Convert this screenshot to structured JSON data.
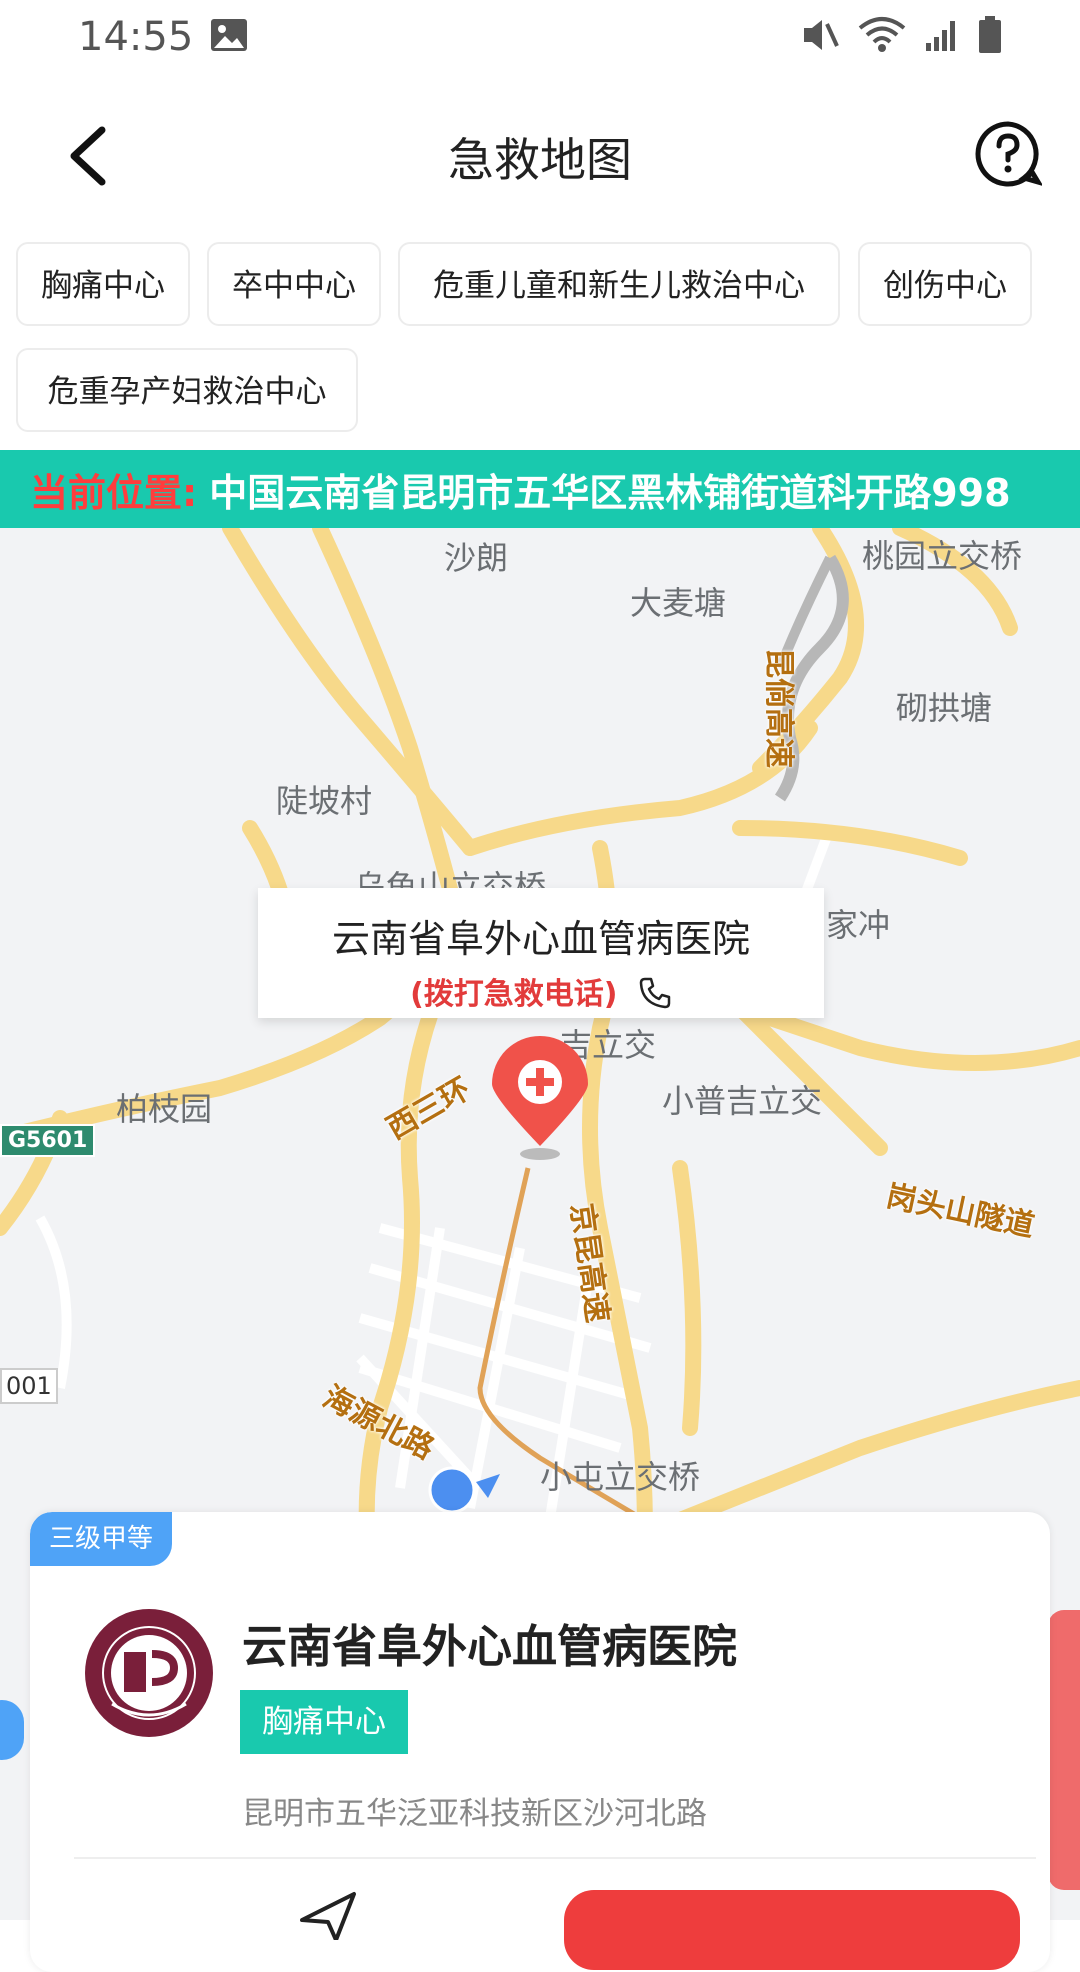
{
  "status": {
    "time": "14:55"
  },
  "header": {
    "title": "急救地图"
  },
  "chips": [
    "胸痛中心",
    "卒中中心",
    "危重儿童和新生儿救治中心",
    "创伤中心",
    "危重孕产妇救治中心"
  ],
  "location": {
    "label": "当前位置:",
    "address": "中国云南省昆明市五华区黑林铺街道科开路998"
  },
  "map": {
    "places": [
      "沙朗",
      "桃园立交桥",
      "大麦塘",
      "砌拱塘",
      "陡坡村",
      "乌龟山立交桥",
      "家冲",
      "吉立交",
      "小普吉立交",
      "柏枝园",
      "小屯立交桥"
    ],
    "roads": [
      "昆倘高速",
      "西三环",
      "京昆高速",
      "岗头山隧道",
      "海源北路"
    ],
    "shields": [
      "G5601",
      "001"
    ]
  },
  "popup": {
    "name": "云南省阜外心血管病医院",
    "call": "(拨打急救电话)"
  },
  "card": {
    "grade": "三级甲等",
    "name": "云南省阜外心血管病医院",
    "tag": "胸痛中心",
    "address": "昆明市五华泛亚科技新区沙河北路"
  },
  "colors": {
    "accent": "#19c9ae",
    "danger": "#ee3d3d",
    "grade": "#4fa3f7"
  }
}
